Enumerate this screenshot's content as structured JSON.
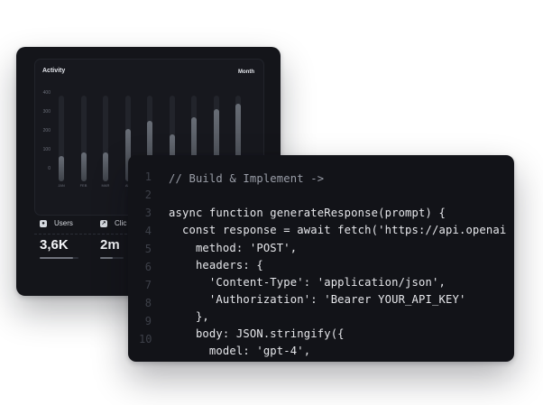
{
  "dashboard": {
    "chart_title": "Activity",
    "period": "Month",
    "chart_data": {
      "type": "bar",
      "title": "Activity",
      "categories": [
        "JAN",
        "FEB",
        "MAR",
        "AP",
        "",
        "",
        "",
        "",
        ""
      ],
      "values": [
        130,
        150,
        150,
        270,
        310,
        240,
        330,
        370,
        400
      ],
      "ylim": [
        0,
        440
      ],
      "y_ticks": [
        "400",
        "300",
        "200",
        "100",
        "0"
      ]
    },
    "stats": [
      {
        "icon": "users-icon",
        "label": "Users",
        "value": "3,6K",
        "progress": 0.85
      },
      {
        "icon": "click-icon",
        "label": "Clic",
        "value": "2m",
        "progress": 0.55
      }
    ]
  },
  "editor": {
    "line_numbers": [
      "1",
      "2",
      "3",
      "4",
      "5",
      "6",
      "7",
      "8",
      "9",
      "10"
    ],
    "lines": [
      "// Build & Implement ->",
      "",
      "async function generateResponse(prompt) {",
      "  const response = await fetch('https://api.openai",
      "    method: 'POST',",
      "    headers: {",
      "      'Content-Type': 'application/json',",
      "      'Authorization': 'Bearer YOUR_API_KEY'",
      "    },",
      "    body: JSON.stringify({",
      "      model: 'gpt-4',"
    ]
  }
}
